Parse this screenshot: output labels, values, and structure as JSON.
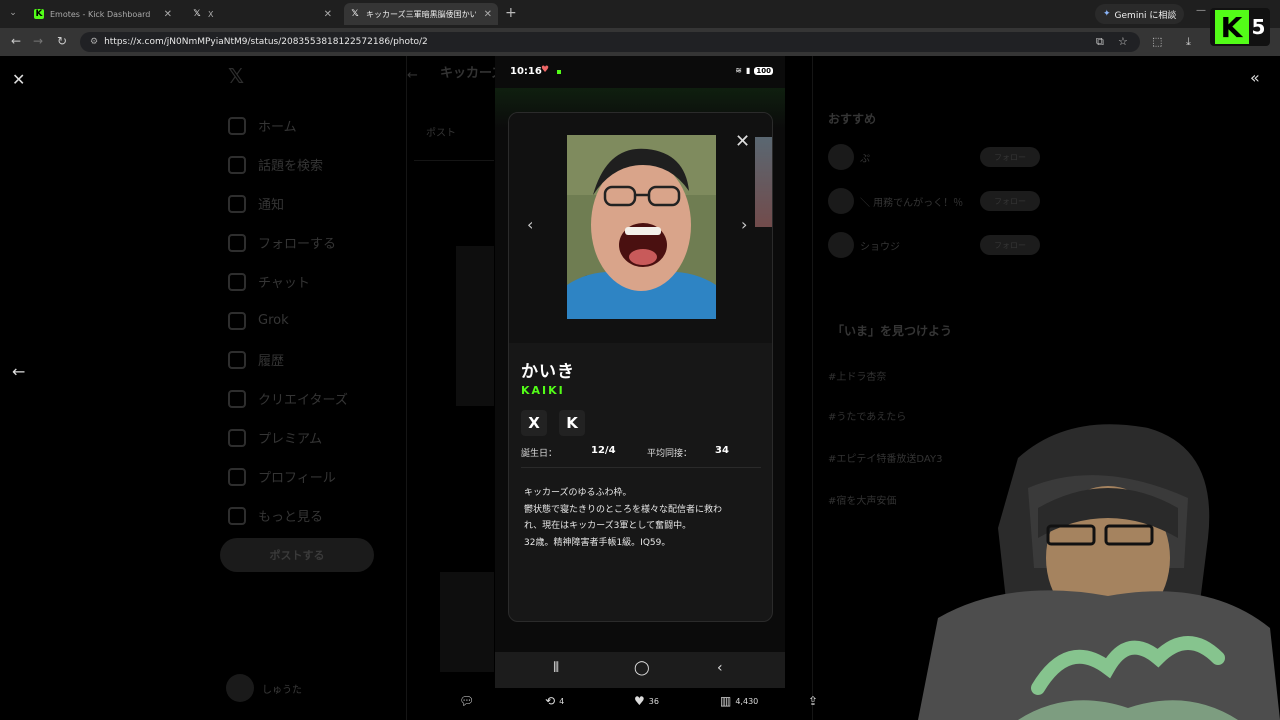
{
  "browser": {
    "tabs": [
      {
        "title": "Emotes - Kick Dashboard",
        "favicon": "kick-icon"
      },
      {
        "title": "X",
        "favicon": "x-icon"
      },
      {
        "title": "キッカーズ三軍暗黒脳倭国かいき",
        "favicon": "x-icon"
      }
    ],
    "new_tab": "+",
    "gemini_label": "Gemini に相談",
    "url": "https://x.com/jN0NmMPyiaNtM9/status/2083553818122572186/photo/2"
  },
  "overlay": {
    "kick_letter": "K",
    "kick_number": "5"
  },
  "x_background": {
    "nav_items": [
      "ホーム",
      "話題を検索",
      "通知",
      "フォローする",
      "チャット",
      "Grok",
      "履歴",
      "クリエイターズ",
      "プレミアム",
      "プロフィール",
      "もっと見る"
    ],
    "post_button": "ポストする",
    "account_name": "しゅうた",
    "header": "キッカーズ",
    "posts_tab": "ポスト",
    "right_heading": "おすすめ",
    "follow_rows": [
      {
        "name": "ぷ",
        "button": "フォロー"
      },
      {
        "name": "＼ 用務でんがっく！％",
        "button": "フォロー"
      },
      {
        "name": "ショウジ",
        "button": "フォロー"
      }
    ],
    "trend_heading": "「いま」を見つけよう",
    "trends": [
      "#上ドラ杏奈",
      "#うたであえたら",
      "#エピテイ特番放送DAY3",
      "#宿を大声安価"
    ]
  },
  "phone": {
    "time": "10:16",
    "battery": "100",
    "card": {
      "name_jp": "かいき",
      "name_en": "KAIKI",
      "social_x": "X",
      "social_kick": "K",
      "birthday_label": "誕生日：",
      "birthday_value": "12/4",
      "avg_label": "平均同接：",
      "avg_value": "34",
      "bio": [
        "キッカーズのゆるふわ枠。",
        "鬱状態で寝たきりのところを様々な配信者に救わ",
        "れ、現在はキッカーズ3軍として奮闘中。",
        "32歳。精神障害者手帳1級。IQ59。"
      ]
    }
  },
  "actions": {
    "reply": "",
    "repost": "4",
    "like": "36",
    "views": "4,430"
  },
  "icons": {
    "close": "close-icon",
    "back": "arrow-left-icon",
    "collapse": "double-chevron-left-icon"
  },
  "colors": {
    "kick_green": "#53fc18"
  }
}
